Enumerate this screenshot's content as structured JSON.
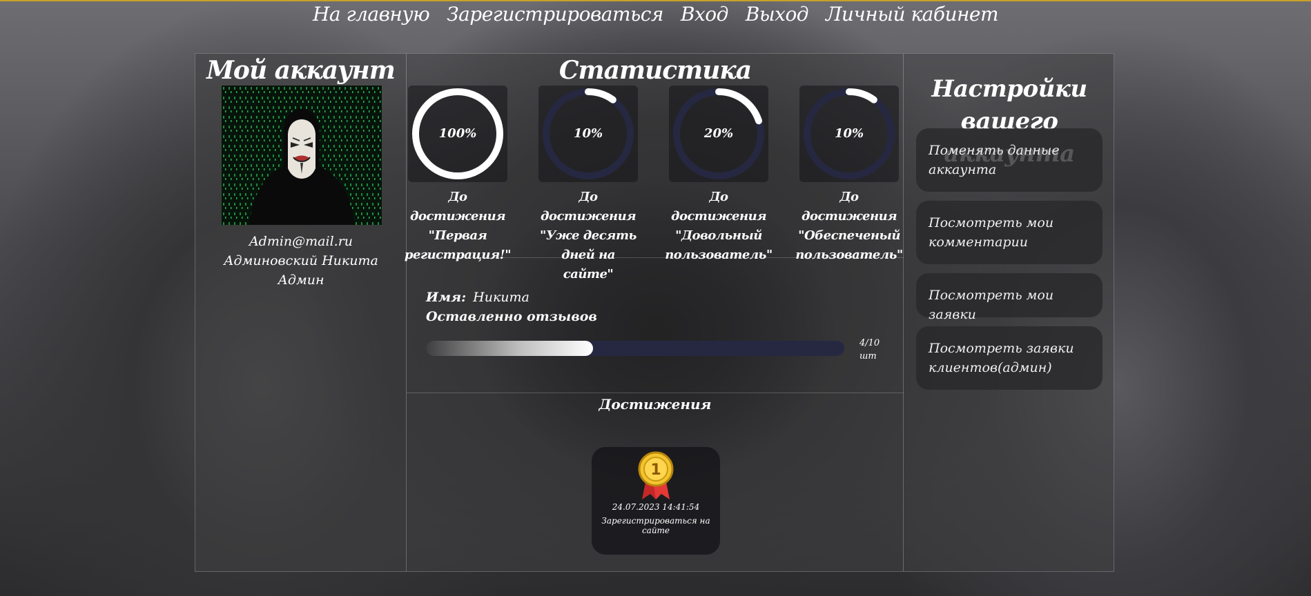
{
  "nav": {
    "items": [
      {
        "label": "На главную"
      },
      {
        "label": "Зарегистрироваться"
      },
      {
        "label": "Вход"
      },
      {
        "label": "Выход"
      },
      {
        "label": "Личный кабинет"
      }
    ]
  },
  "account": {
    "title": "Мой аккаунт",
    "email": "Admin@mail.ru",
    "full_name": "Админовский Никита",
    "role": "Админ"
  },
  "stats": {
    "title": "Статистика",
    "gauges": [
      {
        "value_text": "100%",
        "percent": 100,
        "label": "До достижения \"Первая регистрация!\""
      },
      {
        "value_text": "10%",
        "percent": 10,
        "label": "До достижения \"Уже десять дней на сайте\""
      },
      {
        "value_text": "20%",
        "percent": 20,
        "label": "До достижения \"Довольный пользователь\""
      },
      {
        "value_text": "10%",
        "percent": 10,
        "label": "До достижения \"Обеспеченый пользователь\""
      }
    ],
    "name_label": "Имя:",
    "name_value": "Никита",
    "reviews_label": "Оставленно отзывов",
    "reviews_progress": 0.4,
    "reviews_count": "4/10",
    "reviews_unit": "шт"
  },
  "achievements": {
    "title": "Достижения",
    "items": [
      {
        "date": "24.07.2023 14:41:54",
        "name": "Зарегистрироваться на сайте",
        "icon": "medal-icon"
      }
    ]
  },
  "settings": {
    "title": "Настройки вашего аккаунта",
    "buttons": [
      {
        "label": "Поменять данные аккаунта"
      },
      {
        "label": "Посмотреть мои комментарии"
      },
      {
        "label": "Посмотреть мои заявки"
      },
      {
        "label": "Посмотреть заявки клиентов(админ)"
      }
    ]
  },
  "colors": {
    "accent": "#c9a227",
    "ring_track": "#262842",
    "ring_fill": "#ffffff"
  }
}
